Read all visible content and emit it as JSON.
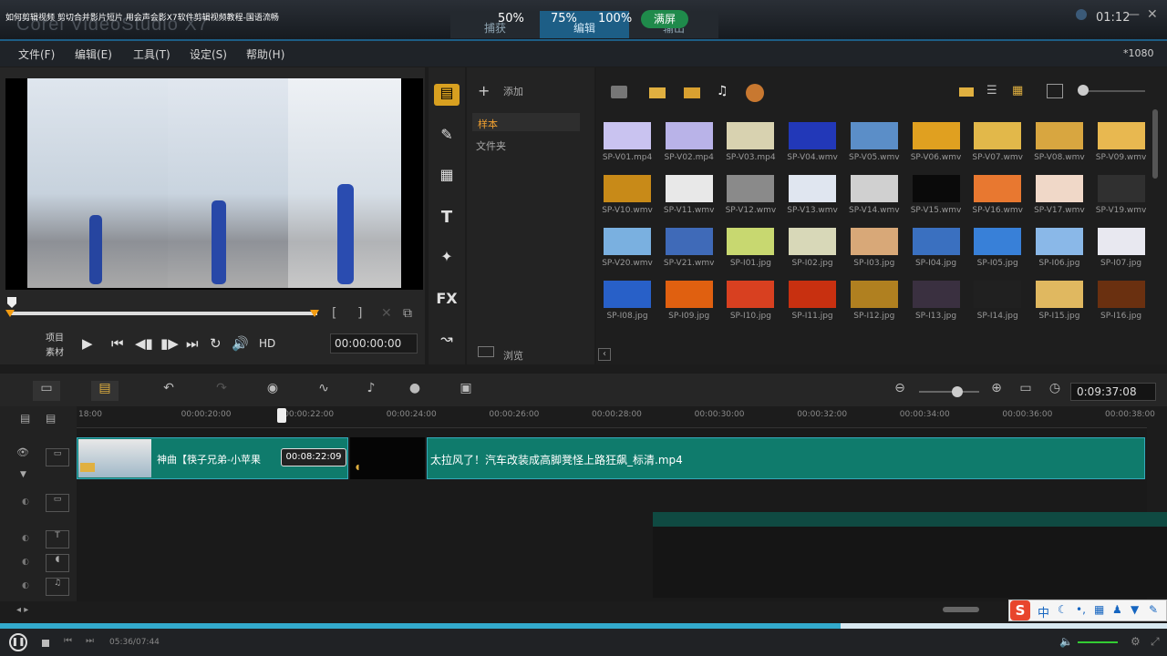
{
  "player": {
    "video_title": "如何剪辑视频 剪切合并影片短片 用会声会影X7软件剪辑视频教程-国语流畅",
    "zoom_options": [
      "50%",
      "75%",
      "100%"
    ],
    "fullscreen_label": "满屏",
    "clock": "01:12",
    "current_time": "05:36/07:44",
    "progress_fraction": 0.72
  },
  "app": {
    "title": "Corel VideoStudio X7",
    "steps": [
      "捕获",
      "编辑",
      "输出"
    ],
    "resolution": "*1080"
  },
  "menu": [
    "文件(F)",
    "编辑(E)",
    "工具(T)",
    "设定(S)",
    "帮助(H)"
  ],
  "preview": {
    "mode_project": "项目",
    "mode_clip": "素材",
    "hd_label": "HD",
    "timecode": "00:00:00:00",
    "controls": [
      "▶",
      "⏮",
      "◀▮",
      "▮▶",
      "⏭",
      "↻",
      "🔊"
    ]
  },
  "library": {
    "add_label": "添加",
    "sample_label": "样本",
    "folder_label": "文件夹",
    "browse_label": "浏览",
    "side_icons": [
      "▤",
      "✎",
      "▦",
      "T",
      "✦",
      "FX",
      "↝"
    ],
    "items": [
      {
        "label": "SP-V01.mp4",
        "color": "#c9c3f0"
      },
      {
        "label": "SP-V02.mp4",
        "color": "#b9b3e8"
      },
      {
        "label": "SP-V03.mp4",
        "color": "#d8d2b0"
      },
      {
        "label": "SP-V04.wmv",
        "color": "#2238b8"
      },
      {
        "label": "SP-V05.wmv",
        "color": "#5b8ec8"
      },
      {
        "label": "SP-V06.wmv",
        "color": "#e0a020"
      },
      {
        "label": "SP-V07.wmv",
        "color": "#e2b84a"
      },
      {
        "label": "SP-V08.wmv",
        "color": "#d8a640"
      },
      {
        "label": "SP-V09.wmv",
        "color": "#e8b850"
      },
      {
        "label": "SP-V10.wmv",
        "color": "#c88a18"
      },
      {
        "label": "SP-V11.wmv",
        "color": "#e8e8e8"
      },
      {
        "label": "SP-V12.wmv",
        "color": "#8a8a8a"
      },
      {
        "label": "SP-V13.wmv",
        "color": "#e0e6f0"
      },
      {
        "label": "SP-V14.wmv",
        "color": "#d0d0d0"
      },
      {
        "label": "SP-V15.wmv",
        "color": "#0a0a0a"
      },
      {
        "label": "SP-V16.wmv",
        "color": "#e87830"
      },
      {
        "label": "SP-V17.wmv",
        "color": "#f0d8c8"
      },
      {
        "label": "SP-V19.wmv",
        "color": "#303030"
      },
      {
        "label": "SP-V20.wmv",
        "color": "#7ab0e0"
      },
      {
        "label": "SP-V21.wmv",
        "color": "#3f6ab8"
      },
      {
        "label": "SP-I01.jpg",
        "color": "#c8d870"
      },
      {
        "label": "SP-I02.jpg",
        "color": "#d8d8b8"
      },
      {
        "label": "SP-I03.jpg",
        "color": "#d8a878"
      },
      {
        "label": "SP-I04.jpg",
        "color": "#3a70c0"
      },
      {
        "label": "SP-I05.jpg",
        "color": "#3880d8"
      },
      {
        "label": "SP-I06.jpg",
        "color": "#8ab8e8"
      },
      {
        "label": "SP-I07.jpg",
        "color": "#e8e8f0"
      },
      {
        "label": "SP-I08.jpg",
        "color": "#2860c8"
      },
      {
        "label": "SP-I09.jpg",
        "color": "#e06010"
      },
      {
        "label": "SP-I10.jpg",
        "color": "#d84020"
      },
      {
        "label": "SP-I11.jpg",
        "color": "#c83010"
      },
      {
        "label": "SP-I12.jpg",
        "color": "#b08020"
      },
      {
        "label": "SP-I13.jpg",
        "color": "#3a3040"
      },
      {
        "label": "SP-I14.jpg",
        "color": "#202020"
      },
      {
        "label": "SP-I15.jpg",
        "color": "#e0b860"
      },
      {
        "label": "SP-I16.jpg",
        "color": "#6a3010"
      }
    ]
  },
  "timeline": {
    "timecode": "0:09:37:08",
    "ruler": [
      "18:00",
      "00:00:20:00",
      "00:00:22:00",
      "00:00:24:00",
      "00:00:26:00",
      "00:00:28:00",
      "00:00:30:00",
      "00:00:32:00",
      "00:00:34:00",
      "00:00:36:00",
      "00:00:38:00"
    ],
    "tooltip": "00:08:22:09",
    "clip1_label": "神曲【筷子兄弟-小苹果",
    "clip2_label": "太拉风了！汽车改装成高脚凳怪上路狂飙_标清.mp4"
  },
  "ime": {
    "logo": "S",
    "lang": "中"
  }
}
